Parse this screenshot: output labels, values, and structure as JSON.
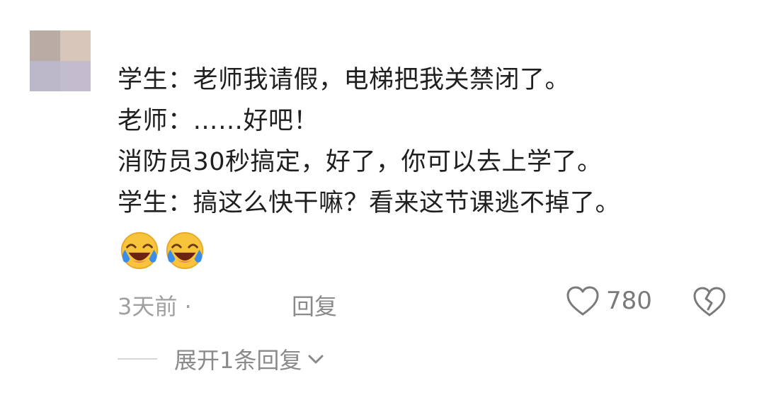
{
  "comment": {
    "lines": [
      "学生：老师我请假，电梯把我关禁闭了。",
      "老师：……好吧！",
      "消防员30秒搞定，好了，你可以去上学了。",
      "学生：搞这么快干嘛？看来这节课逃不掉了。"
    ],
    "emojis": [
      "laughing-tears-emoji",
      "laughing-tears-emoji"
    ]
  },
  "meta": {
    "time": "3天前 ·",
    "reply_label": "回复",
    "like_count": "780"
  },
  "expand_replies_label": "展开1条回复",
  "colors": {
    "text": "#1f1f1f",
    "meta_text": "#a0a0a0",
    "emoji_yellow": "#f7c43c",
    "emoji_tear": "#3b8ee8"
  }
}
